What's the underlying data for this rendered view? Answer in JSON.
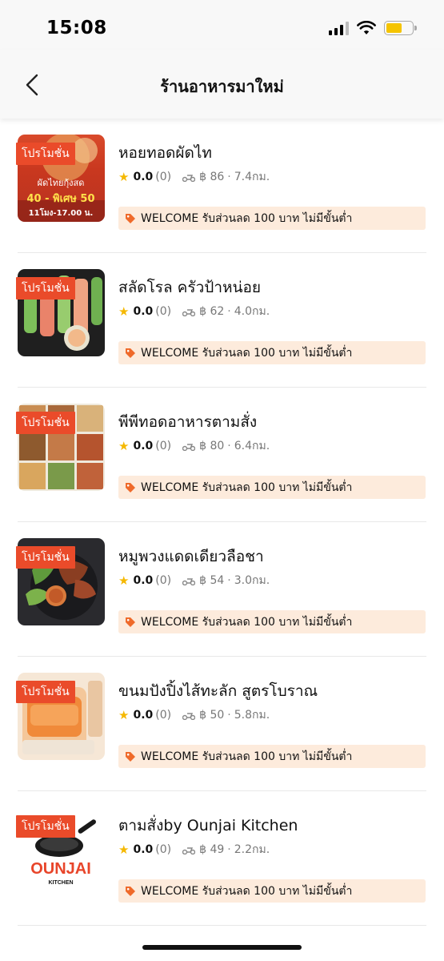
{
  "status_bar": {
    "time": "15:08"
  },
  "header": {
    "title": "ร้านอาหารมาใหม่",
    "back_icon": "chevron-left-icon"
  },
  "colors": {
    "promo": "#ea4b2a",
    "coupon_bg": "#fdebdc",
    "star": "#f5b800",
    "coupon_icon": "#ef6a2a"
  },
  "restaurants": [
    {
      "name": "หอยทอดผัดไท",
      "promo": "โปรโมชั่น",
      "rating": "0.0",
      "reviews": "(0)",
      "delivery_fee": "฿ 86",
      "distance": "7.4กม.",
      "coupon": "WELCOME รับส่วนลด 100 บาท ไม่มีขั้นต่ำ",
      "thumb_text": [
        "ผัดไทยกุ้งสด",
        "40 - พิเศษ 50",
        "11โมง-17.00 น."
      ]
    },
    {
      "name": "สลัดโรล ครัวป้าหน่อย",
      "promo": "โปรโมชั่น",
      "rating": "0.0",
      "reviews": "(0)",
      "delivery_fee": "฿ 62",
      "distance": "4.0กม.",
      "coupon": "WELCOME รับส่วนลด 100 บาท ไม่มีขั้นต่ำ"
    },
    {
      "name": "พีพีทอดอาหารตามสั่ง",
      "promo": "โปรโมชั่น",
      "rating": "0.0",
      "reviews": "(0)",
      "delivery_fee": "฿ 80",
      "distance": "6.4กม.",
      "coupon": "WELCOME รับส่วนลด 100 บาท ไม่มีขั้นต่ำ"
    },
    {
      "name": "หมูพวงแดดเดียวลือชา",
      "promo": "โปรโมชั่น",
      "rating": "0.0",
      "reviews": "(0)",
      "delivery_fee": "฿ 54",
      "distance": "3.0กม.",
      "coupon": "WELCOME รับส่วนลด 100 บาท ไม่มีขั้นต่ำ"
    },
    {
      "name": "ขนมปังปิ้งไส้ทะลัก สูตรโบราณ",
      "promo": "โปรโมชั่น",
      "rating": "0.0",
      "reviews": "(0)",
      "delivery_fee": "฿ 50",
      "distance": "5.8กม.",
      "coupon": "WELCOME รับส่วนลด 100 บาท ไม่มีขั้นต่ำ"
    },
    {
      "name": "ตามสั่งby Ounjai Kitchen",
      "promo": "โปรโมชั่น",
      "rating": "0.0",
      "reviews": "(0)",
      "delivery_fee": "฿ 49",
      "distance": "2.2กม.",
      "coupon": "WELCOME รับส่วนลด 100 บาท ไม่มีขั้นต่ำ",
      "thumb_text": [
        "OUNJAI",
        "KITCHEN"
      ]
    }
  ]
}
